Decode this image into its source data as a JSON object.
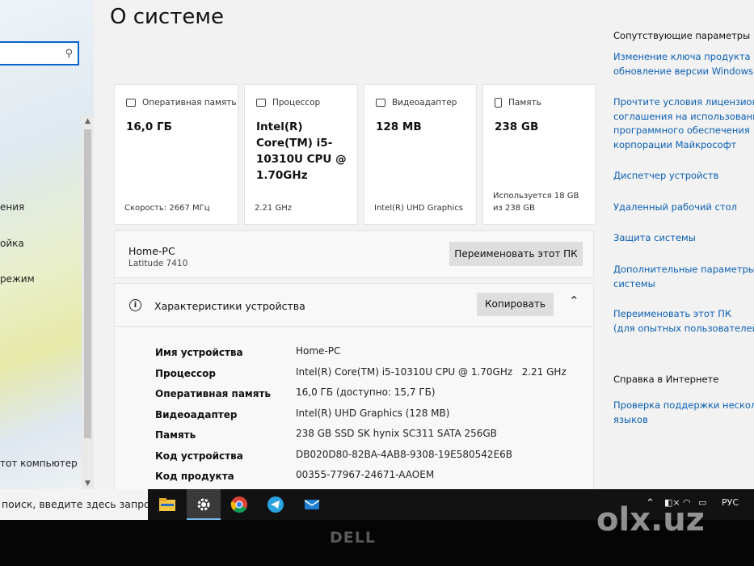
{
  "page_title": "О системе",
  "sidebar": {
    "search": {
      "value": "",
      "placeholder": ""
    },
    "items": [
      "ения",
      "ойка",
      "режим",
      "тот компьютер"
    ]
  },
  "cards": [
    {
      "title": "Оперативная память",
      "value": "16,0 ГБ",
      "footer": "Скорость: 2667 МГц"
    },
    {
      "title": "Процессор",
      "value": "Intel(R) Core(TM) i5-10310U CPU @ 1.70GHz",
      "footer": "2.21 GHz"
    },
    {
      "title": "Видеоадаптер",
      "value": "128 MB",
      "footer": "Intel(R) UHD Graphics"
    },
    {
      "title": "Память",
      "value": "238 GB",
      "footer": "Используется 18 GB из 238 GB"
    }
  ],
  "pc": {
    "name": "Home-PC",
    "model": "Latitude 7410",
    "rename_label": "Переименовать этот ПК"
  },
  "specs": {
    "title": "Характеристики устройства",
    "copy_label": "Копировать",
    "rows": [
      {
        "key": "Имя устройства",
        "value": "Home-PC"
      },
      {
        "key": "Процессор",
        "value": "Intel(R) Core(TM) i5-10310U CPU @ 1.70GHz   2.21 GHz"
      },
      {
        "key": "Оперативная память",
        "value": "16,0 ГБ (доступно: 15,7 ГБ)"
      },
      {
        "key": "Видеоадаптер",
        "value": "Intel(R) UHD Graphics (128 MB)"
      },
      {
        "key": "Память",
        "value": "238 GB SSD SK hynix SC311 SATA 256GB"
      },
      {
        "key": "Код устройства",
        "value": "DB020D80-82BA-4AB8-9308-19E580542E6B"
      },
      {
        "key": "Код продукта",
        "value": "00355-77967-24671-AAOEM"
      }
    ]
  },
  "related": {
    "heading": "Сопутствующие параметры",
    "links": [
      "Изменение ключа продукта или\nобновление версии Windows",
      "Прочтите условия лицензионного\nсоглашения на использование\nпрограммного обеспечения\nкорпорации Майкрософт",
      "Диспетчер устройств",
      "Удаленный рабочий стол",
      "Защита системы",
      "Дополнительные параметры\nсистемы",
      "Переименовать этот ПК\n(для опытных пользователей)"
    ],
    "help_heading": "Справка в Интернете",
    "help_link": "Проверка поддержки нескольких\nязыков"
  },
  "taskbar": {
    "search_text": "поиск, введите здесь запрос",
    "lang": "РУС"
  },
  "bezel": {
    "brand": "DELL",
    "watermark": "olx.uz"
  },
  "colors": {
    "link": "#0a5fb4",
    "accent": "#0a63c9",
    "taskbar": "#121212"
  }
}
